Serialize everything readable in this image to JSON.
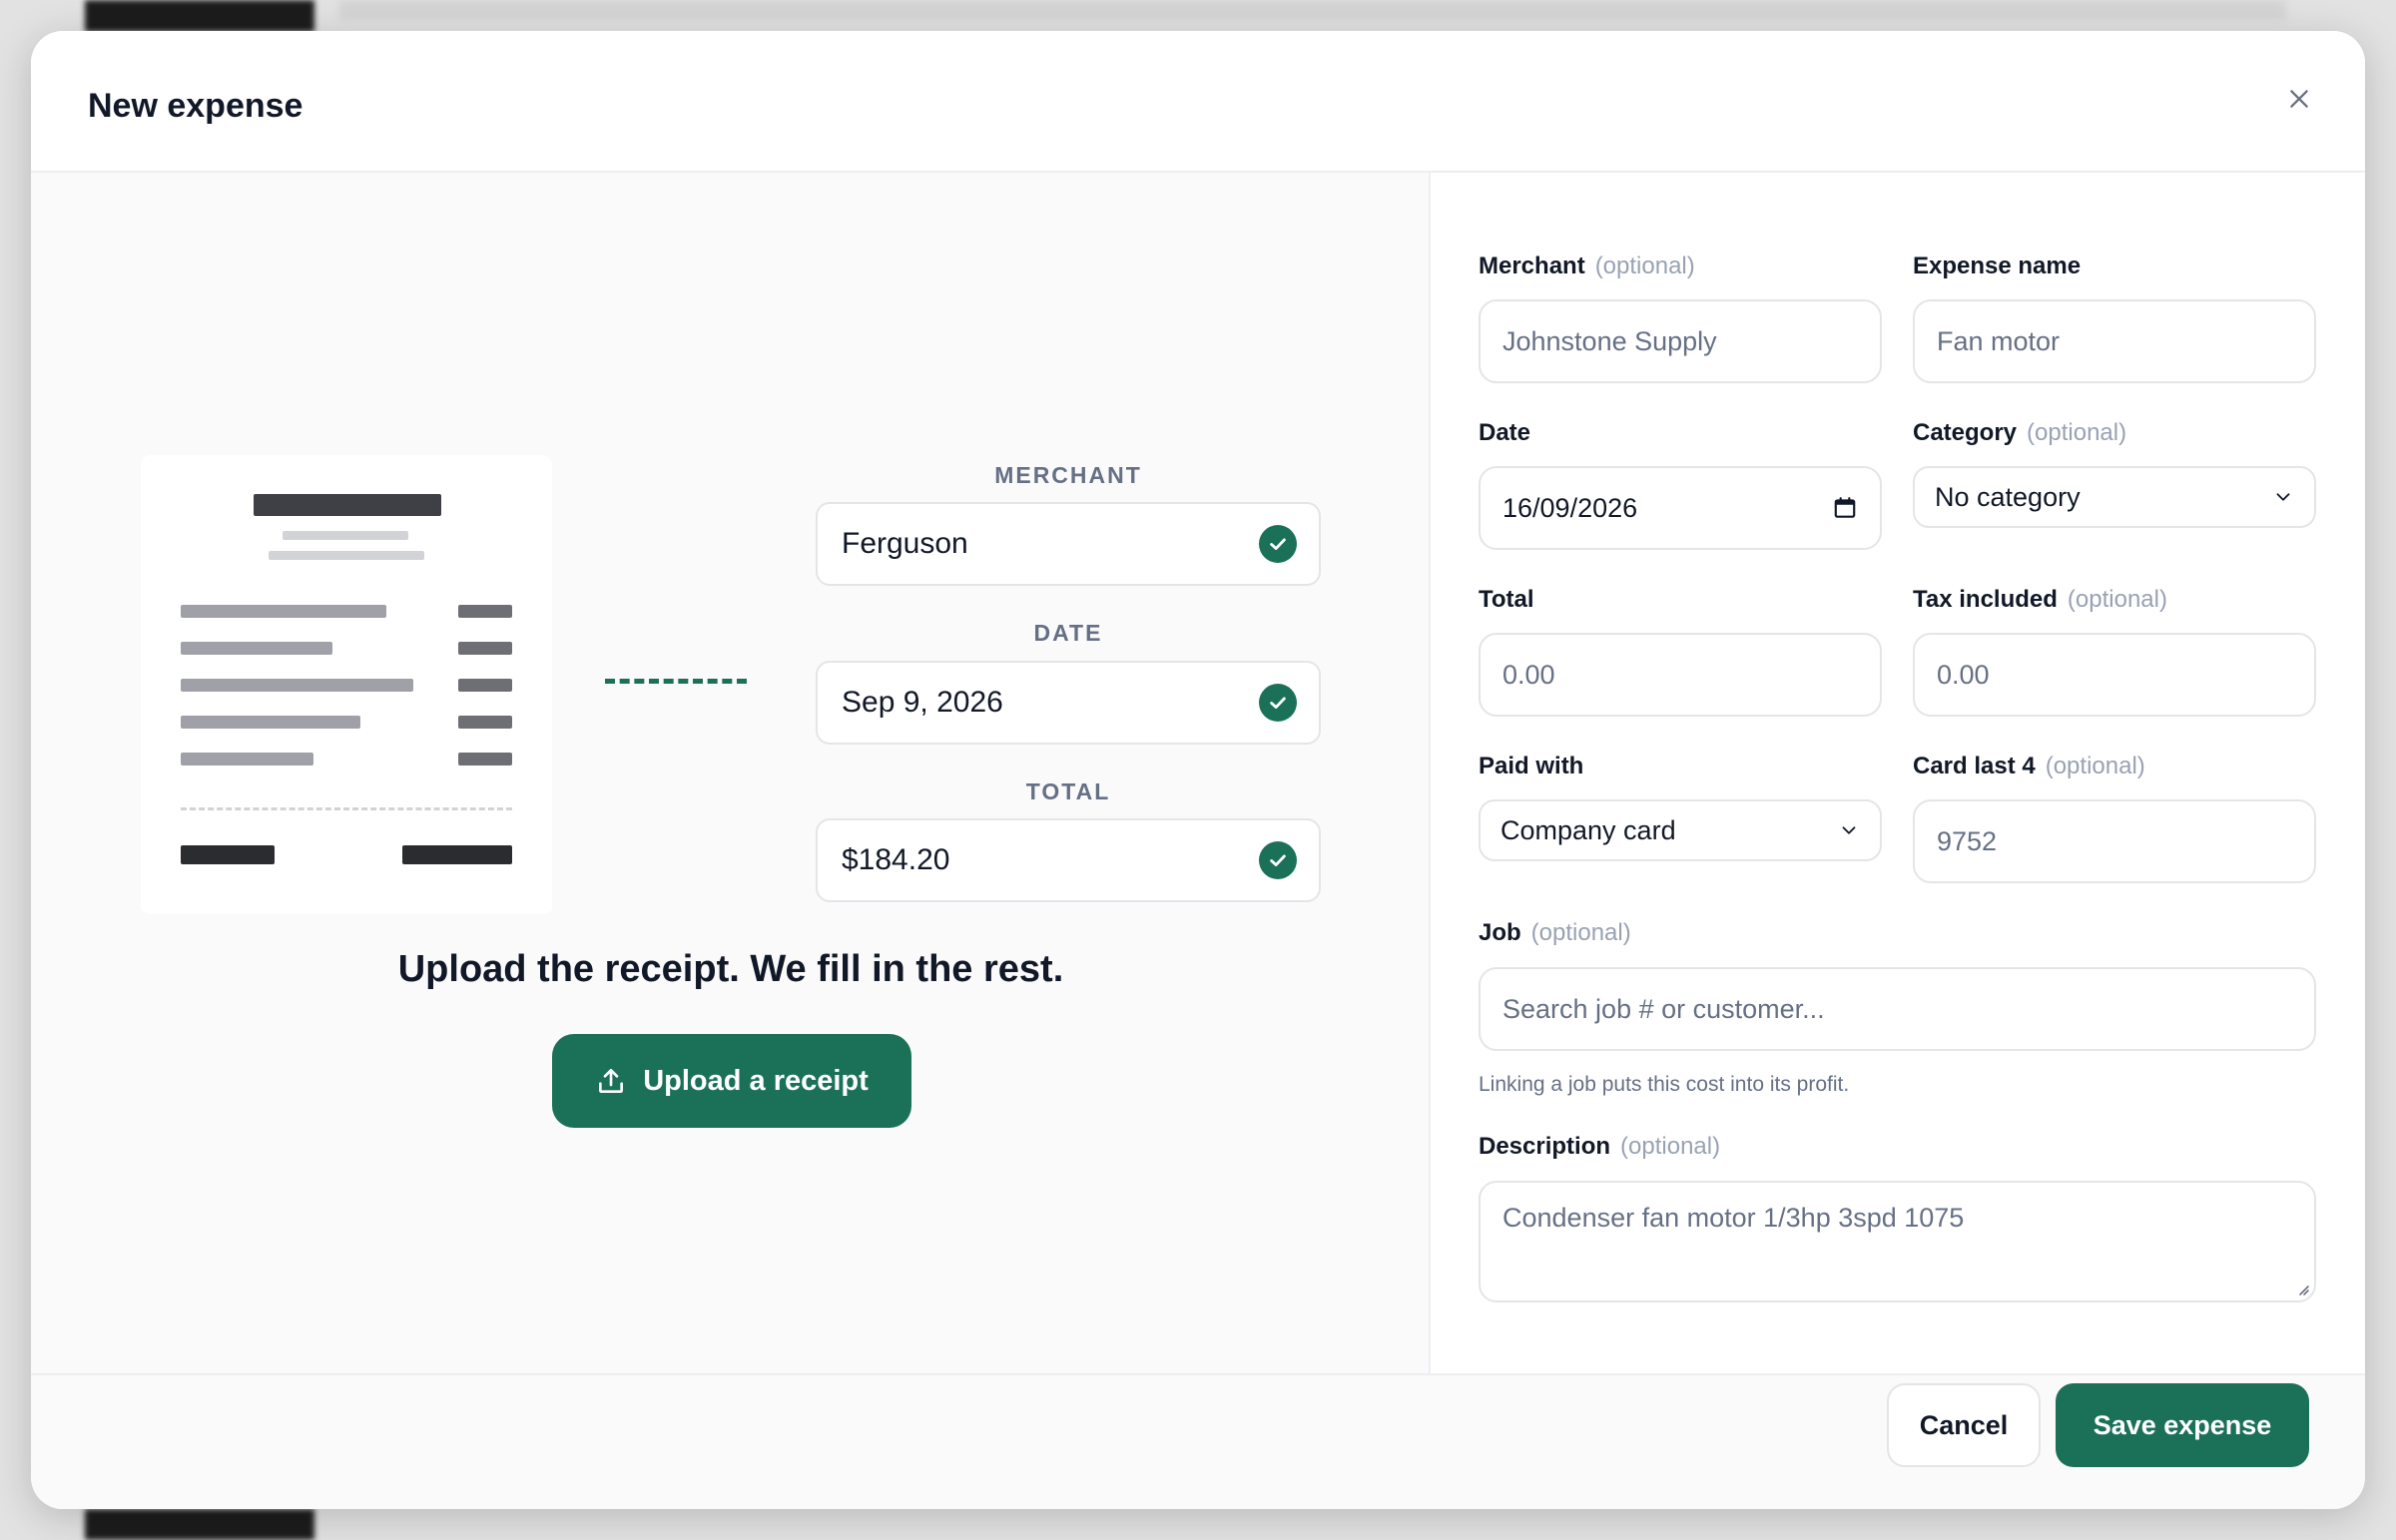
{
  "modal": {
    "title": "New expense"
  },
  "left": {
    "extracted": [
      {
        "label": "MERCHANT",
        "value": "Ferguson"
      },
      {
        "label": "DATE",
        "value": "Sep 9, 2026"
      },
      {
        "label": "TOTAL",
        "value": "$184.20"
      }
    ],
    "headline": "Upload the receipt. We fill in the rest.",
    "upload_label": "Upload a receipt"
  },
  "form": {
    "optional_text": "(optional)",
    "merchant": {
      "label": "Merchant",
      "placeholder": "Johnstone Supply"
    },
    "expense_name": {
      "label": "Expense name",
      "placeholder": "Fan motor"
    },
    "date": {
      "label": "Date",
      "value": "16/09/2026"
    },
    "category": {
      "label": "Category",
      "value": "No category"
    },
    "total": {
      "label": "Total",
      "placeholder": "0.00"
    },
    "tax": {
      "label": "Tax included",
      "placeholder": "0.00"
    },
    "paid_with": {
      "label": "Paid with",
      "value": "Company card"
    },
    "card_last4": {
      "label": "Card last 4",
      "placeholder": "9752"
    },
    "job": {
      "label": "Job",
      "placeholder": "Search job # or customer...",
      "helper": "Linking a job puts this cost into its profit."
    },
    "description": {
      "label": "Description",
      "placeholder": "Condenser fan motor 1/3hp 3spd 1075"
    }
  },
  "footer": {
    "cancel_label": "Cancel",
    "save_label": "Save expense"
  },
  "colors": {
    "accent": "#1b7158"
  }
}
